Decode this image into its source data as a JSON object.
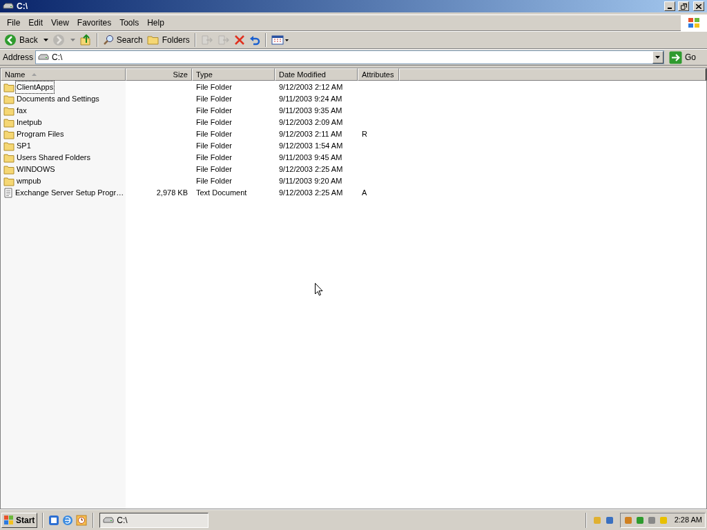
{
  "window": {
    "title": "C:\\"
  },
  "menu": [
    "File",
    "Edit",
    "View",
    "Favorites",
    "Tools",
    "Help"
  ],
  "toolbar": [
    {
      "kind": "back",
      "label": "Back",
      "disabled": false
    },
    {
      "kind": "forward",
      "disabled": true
    },
    {
      "kind": "up",
      "disabled": false
    },
    {
      "kind": "sep"
    },
    {
      "kind": "search",
      "label": "Search",
      "disabled": false
    },
    {
      "kind": "folders",
      "label": "Folders",
      "disabled": false
    },
    {
      "kind": "sep"
    },
    {
      "kind": "moveto",
      "disabled": true
    },
    {
      "kind": "copyto",
      "disabled": true
    },
    {
      "kind": "delete",
      "disabled": false
    },
    {
      "kind": "undo",
      "disabled": false
    },
    {
      "kind": "sep"
    },
    {
      "kind": "views",
      "disabled": false
    }
  ],
  "address": {
    "label": "Address",
    "value": "C:\\",
    "go": "Go"
  },
  "columns": [
    {
      "label": "Name",
      "sorted": true
    },
    {
      "label": "Size",
      "sorted": false
    },
    {
      "label": "Type",
      "sorted": false
    },
    {
      "label": "Date Modified",
      "sorted": false
    },
    {
      "label": "Attributes",
      "sorted": false
    }
  ],
  "rows": [
    {
      "kind": "folder",
      "selected": true,
      "name": "ClientApps",
      "type": "File Folder",
      "date": "9/12/2003 2:12 AM"
    },
    {
      "kind": "folder",
      "selected": false,
      "name": "Documents and Settings",
      "type": "File Folder",
      "date": "9/11/2003 9:24 AM"
    },
    {
      "kind": "folder",
      "selected": false,
      "name": "fax",
      "type": "File Folder",
      "date": "9/11/2003 9:35 AM"
    },
    {
      "kind": "folder",
      "selected": false,
      "name": "Inetpub",
      "type": "File Folder",
      "date": "9/12/2003 2:09 AM"
    },
    {
      "kind": "folder",
      "selected": false,
      "name": "Program Files",
      "type": "File Folder",
      "date": "9/12/2003 2:11 AM",
      "attributes": "R"
    },
    {
      "kind": "folder",
      "selected": false,
      "name": "SP1",
      "type": "File Folder",
      "date": "9/12/2003 1:54 AM"
    },
    {
      "kind": "folder",
      "selected": false,
      "name": "Users Shared Folders",
      "type": "File Folder",
      "date": "9/11/2003 9:45 AM"
    },
    {
      "kind": "folder",
      "selected": false,
      "name": "WINDOWS",
      "type": "File Folder",
      "date": "9/12/2003 2:25 AM"
    },
    {
      "kind": "folder",
      "selected": false,
      "name": "wmpub",
      "type": "File Folder",
      "date": "9/11/2003 9:20 AM"
    },
    {
      "kind": "text",
      "selected": false,
      "name": "Exchange Server Setup Progr…",
      "size": "2,978 KB",
      "type": "Text Document",
      "date": "9/12/2003 2:25 AM",
      "attributes": "A"
    }
  ],
  "taskbar": {
    "start": "Start",
    "tasks": [
      {
        "label": "C:\\",
        "selected": true
      }
    ],
    "clock": "2:28 AM"
  }
}
